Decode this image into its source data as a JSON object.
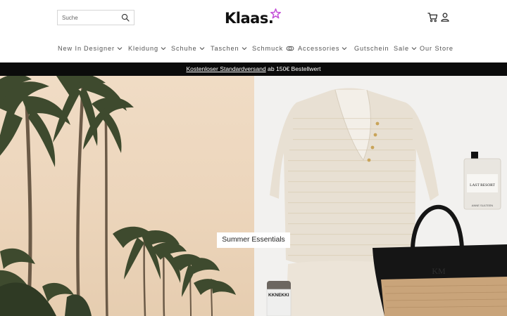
{
  "header": {
    "search": {
      "placeholder": "Suche",
      "icon": "search-icon"
    },
    "logo": {
      "text": "Klaas.",
      "star_color": "#c44fd8"
    },
    "icons": [
      "cart-icon",
      "user-icon"
    ]
  },
  "nav": {
    "items": [
      {
        "label": "New In",
        "dropdown": false
      },
      {
        "label": "Designer",
        "dropdown": true
      },
      {
        "label": "Kleidung",
        "dropdown": true
      },
      {
        "label": "Schuhe",
        "dropdown": true
      },
      {
        "label": "Taschen",
        "dropdown": true
      },
      {
        "label": "Schmuck",
        "dropdown": false,
        "icon": "ring-icon"
      },
      {
        "label": "Accessories",
        "dropdown": true
      },
      {
        "label": "Gutschein",
        "dropdown": false
      },
      {
        "label": "Sale",
        "dropdown": true
      },
      {
        "label": "Our Store",
        "dropdown": false
      }
    ]
  },
  "promo": {
    "link_text": "Kostenloser Standardversand",
    "rest_text": " ab 150€ Bestellwert",
    "background": "#0b0b0b"
  },
  "hero": {
    "cta_label": "Summer Essentials",
    "perfume_label_1": "LAST RESORT",
    "perfume_label_2": "ANNE SULTEEN",
    "hair_tie_label": "KKNEKKI"
  }
}
